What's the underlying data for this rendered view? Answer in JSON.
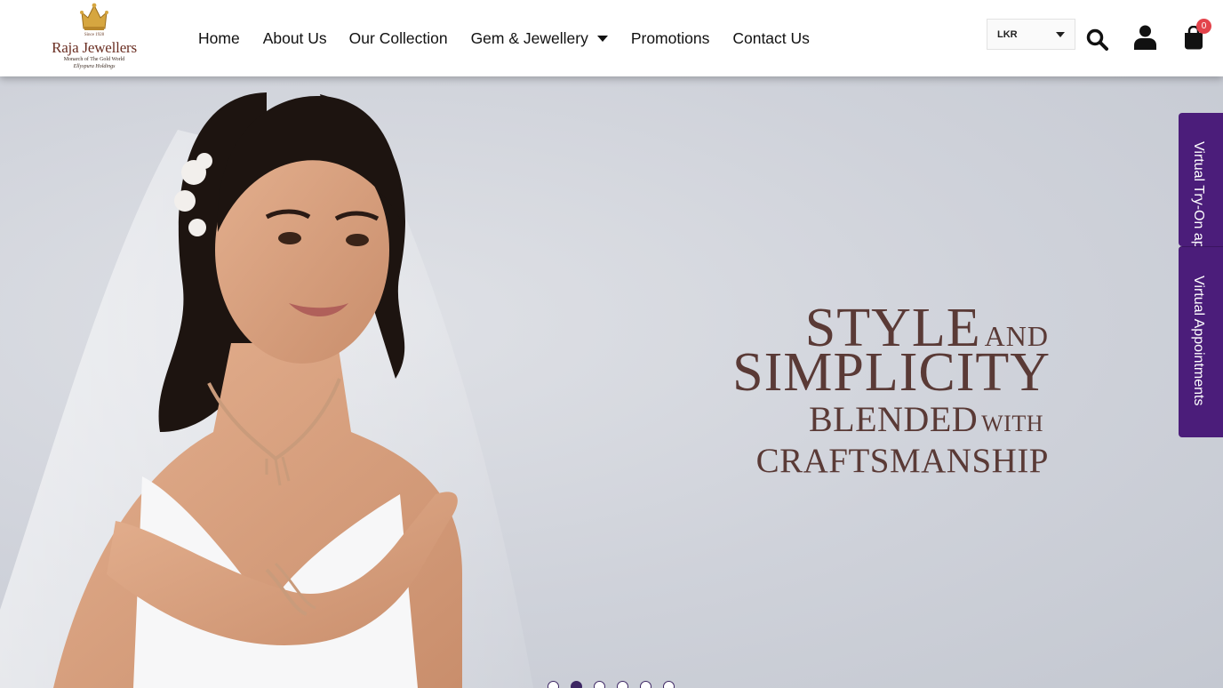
{
  "logo": {
    "since": "Since 1928",
    "brand": "Raja Jewellers",
    "tagline": "Monarch of The Gold World",
    "holding": "Ellyspura Holdings"
  },
  "nav": {
    "items": [
      {
        "label": "Home"
      },
      {
        "label": "About Us"
      },
      {
        "label": "Our Collection"
      },
      {
        "label": "Gem & Jewellery"
      },
      {
        "label": "Promotions"
      },
      {
        "label": "Contact Us"
      }
    ]
  },
  "currency": {
    "selected": "LKR"
  },
  "cart": {
    "count": "0"
  },
  "icons": {
    "search": "search-icon",
    "account": "user-icon",
    "cart": "shopping-bag-icon",
    "dropdown": "chevron-down-icon"
  },
  "hero": {
    "line1_big": "STYLE",
    "line1_small": "AND",
    "line2": "SIMPLICITY",
    "line3_big": "BLENDED",
    "line3_small": "WITH",
    "line4": "CRAFTSMANSHIP",
    "slide_count": 6,
    "active_slide": 2
  },
  "side_tabs": {
    "try_on": "Virtual Try-On app",
    "appointments": "Virtual Appointments"
  },
  "colors": {
    "accent": "#4b1d7a",
    "headline": "#5a3a36",
    "badge": "#e3434b"
  }
}
